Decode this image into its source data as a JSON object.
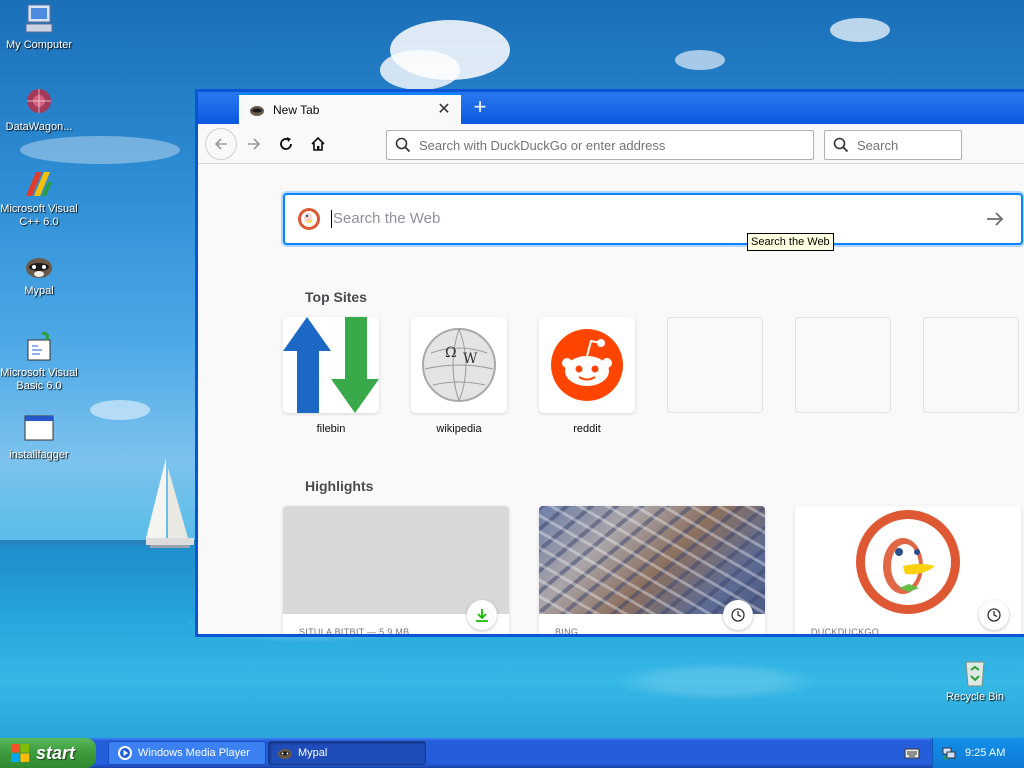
{
  "desktop": {
    "icons": [
      {
        "label": "My Computer",
        "icon": "my-computer-icon"
      },
      {
        "label": "DataWagon...",
        "icon": "datawagon-icon"
      },
      {
        "label": "Microsoft Visual C++ 6.0",
        "icon": "visual-cpp-icon"
      },
      {
        "label": "Mypal",
        "icon": "mypal-icon"
      },
      {
        "label": "Microsoft Visual Basic 6.0",
        "icon": "visual-basic-icon"
      },
      {
        "label": "installfagger",
        "icon": "installer-window-icon"
      }
    ],
    "recycle_bin": {
      "label": "Recycle Bin",
      "icon": "recycle-bin-icon"
    }
  },
  "browser": {
    "tab": {
      "title": "New Tab"
    },
    "urlbar": {
      "placeholder": "Search with DuckDuckGo or enter address"
    },
    "searchbar": {
      "placeholder": "Search"
    },
    "web_search": {
      "placeholder": "Search the Web",
      "tooltip": "Search the Web"
    },
    "top_sites": {
      "title": "Top Sites",
      "items": [
        {
          "label": "filebin",
          "icon": "filebin-icon"
        },
        {
          "label": "wikipedia",
          "icon": "wikipedia-icon"
        },
        {
          "label": "reddit",
          "icon": "reddit-icon"
        },
        {
          "label": ""
        },
        {
          "label": ""
        },
        {
          "label": ""
        }
      ]
    },
    "highlights": {
      "title": "Highlights",
      "items": [
        {
          "source": "SITULA BITBIT — 5.9 MB",
          "badge": "download-icon"
        },
        {
          "source": "BING",
          "badge": "clock-icon"
        },
        {
          "source": "DUCKDUCKGO",
          "badge": "clock-icon"
        }
      ]
    }
  },
  "taskbar": {
    "start_label": "start",
    "tasks": [
      {
        "label": "Windows Media Player",
        "icon": "media-player-icon"
      },
      {
        "label": "Mypal",
        "icon": "mypal-icon"
      }
    ],
    "clock": "9:25 AM"
  },
  "colors": {
    "accent": "#0a84ff",
    "xp_blue": "#245edb",
    "start_green": "#3c9a3c"
  }
}
